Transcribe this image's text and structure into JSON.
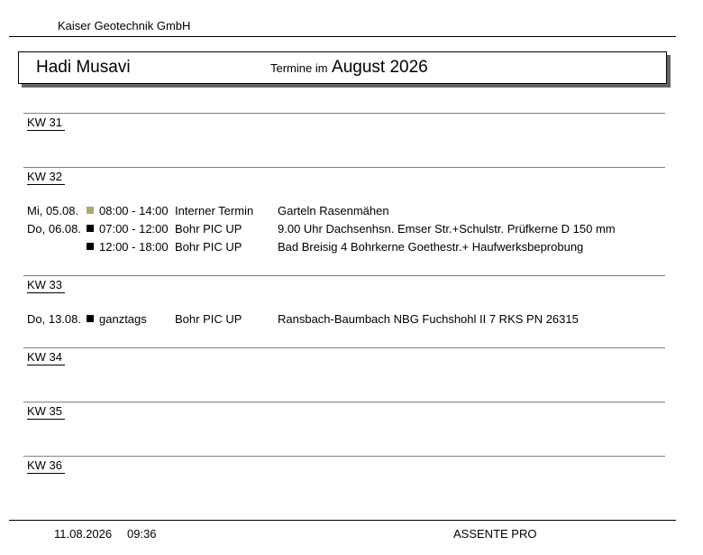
{
  "company": "Kaiser Geotechnik GmbH",
  "header": {
    "person": "Hadi Musavi",
    "period_prefix": "Termine im",
    "period": "August 2026"
  },
  "weeks": [
    {
      "label": "KW 31",
      "entries": []
    },
    {
      "label": "KW 32",
      "entries": [
        {
          "day": "Mi, 05.08.",
          "marker_color": "#b0a868",
          "time": "08:00 - 14:00",
          "type": "Interner Termin",
          "text": "Garteln Rasenmähen"
        },
        {
          "day": "Do, 06.08.",
          "marker_color": "#000000",
          "time": "07:00 - 12:00",
          "type": "Bohr PIC UP",
          "text": "9.00 Uhr Dachsenhsn. Emser Str.+Schulstr. Prüfkerne D 150 mm"
        },
        {
          "day": "",
          "marker_color": "#000000",
          "time": "12:00 - 18:00",
          "type": "Bohr PIC UP",
          "text": "Bad Breisig 4 Bohrkerne Goethestr.+ Haufwerksbeprobung"
        }
      ]
    },
    {
      "label": "KW 33",
      "entries": [
        {
          "day": "Do, 13.08.",
          "marker_color": "#000000",
          "time": "ganztags",
          "type": "Bohr PIC UP",
          "text": "Ransbach-Baumbach NBG Fuchshohl II 7 RKS PN 26315"
        }
      ]
    },
    {
      "label": "KW 34",
      "entries": []
    },
    {
      "label": "KW 35",
      "entries": []
    },
    {
      "label": "KW 36",
      "entries": []
    }
  ],
  "footer": {
    "date": "11.08.2026",
    "time": "09:36",
    "app": "ASSENTE PRO"
  }
}
